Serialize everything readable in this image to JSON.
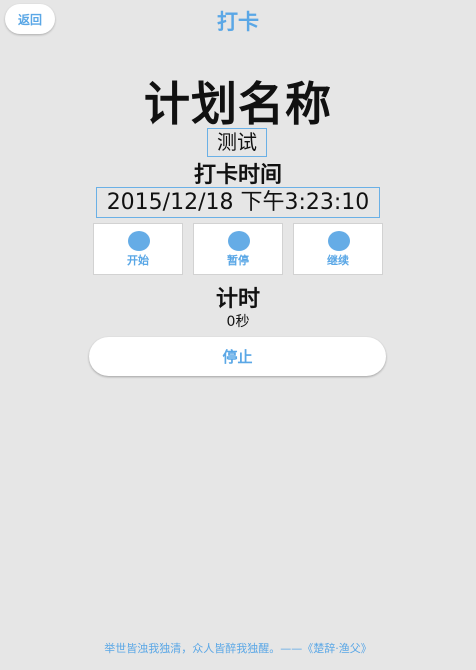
{
  "header": {
    "back_label": "返回",
    "title": "打卡"
  },
  "plan": {
    "heading": "计划名称",
    "value": "测试"
  },
  "checkin": {
    "heading": "打卡时间",
    "value": "2015/12/18 下午3:23:10"
  },
  "controls": [
    {
      "label": "开始"
    },
    {
      "label": "暂停"
    },
    {
      "label": "继续"
    }
  ],
  "timer": {
    "heading": "计时",
    "value": "0秒"
  },
  "stop_label": "停止",
  "footer_quote": "举世皆浊我独清，众人皆醉我独醒。——《楚辞·渔父》",
  "colors": {
    "accent": "#5aa7e6",
    "background": "#e6e6e6"
  }
}
